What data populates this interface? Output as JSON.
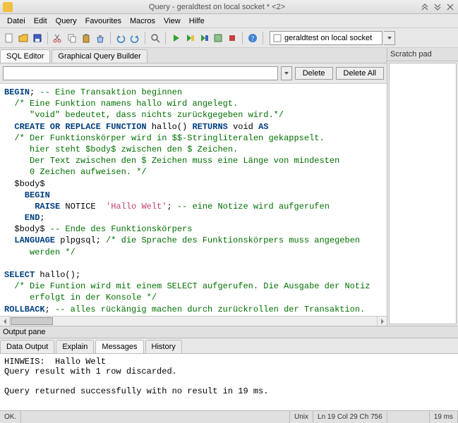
{
  "titlebar": {
    "title": "Query - geraldtest on local socket * <2>"
  },
  "menubar": [
    "Datei",
    "Edit",
    "Query",
    "Favourites",
    "Macros",
    "View",
    "Hilfe"
  ],
  "connection": {
    "label": "geraldtest on local socket"
  },
  "editor_tabs": {
    "sql": "SQL Editor",
    "graphical": "Graphical Query Builder"
  },
  "query_toolbar": {
    "delete": "Delete",
    "delete_all": "Delete All"
  },
  "sql": {
    "l1a": "BEGIN",
    "l1b": "; ",
    "l1c": "-- Eine Transaktion beginnen",
    "l2": "  /* Eine Funktion namens hallo wird angelegt.",
    "l3": "     \"void\" bedeutet, dass nichts zurückgegeben wird.*/",
    "l4a": "  CREATE OR REPLACE FUNCTION",
    "l4b": " hallo() ",
    "l4c": "RETURNS",
    "l4d": " void ",
    "l4e": "AS",
    "l5": "  /* Der Funktionskörper wird in $$-Stringliteralen gekappselt.",
    "l6": "     hier steht $body$ zwischen den $ Zeichen.",
    "l7": "     Der Text zwischen den $ Zeichen muss eine Länge von mindesten",
    "l8": "     0 Zeichen aufweisen. */",
    "l9": "  $body$",
    "l10": "    BEGIN",
    "l11a": "      RAISE",
    "l11b": " NOTICE  ",
    "l11c": "'Hallo Welt'",
    "l11d": "; ",
    "l11e": "-- eine Notize wird aufgerufen",
    "l12": "    END",
    "l12b": ";",
    "l13a": "  $body$ ",
    "l13b": "-- Ende des Funktionskörpers",
    "l14a": "  LANGUAGE",
    "l14b": " plpgsql; ",
    "l14c": "/* die Sprache des Funktionskörpers muss angegeben",
    "l15": "     werden */",
    "blank1": "",
    "l16a": "SELECT",
    "l16b": " hallo();",
    "l17": "  /* Die Funtion wird mit einem SELECT aufgerufen. Die Ausgabe der Notiz",
    "l18": "     erfolgt in der Konsole */",
    "l19a": "ROLLBACK",
    "l19b": "; ",
    "l19c": "-- alles rückängig machen durch zurückrollen der Transaktion."
  },
  "scratchpad": {
    "title": "Scratch pad"
  },
  "output": {
    "header": "Output pane",
    "tabs": {
      "data": "Data Output",
      "explain": "Explain",
      "messages": "Messages",
      "history": "History"
    },
    "body": "HINWEIS:  Hallo Welt\nQuery result with 1 row discarded.\n\nQuery returned successfully with no result in 19 ms."
  },
  "statusbar": {
    "ok": "OK.",
    "enc": "Unix",
    "pos": "Ln 19 Col 29 Ch 756",
    "time": "19 ms"
  }
}
